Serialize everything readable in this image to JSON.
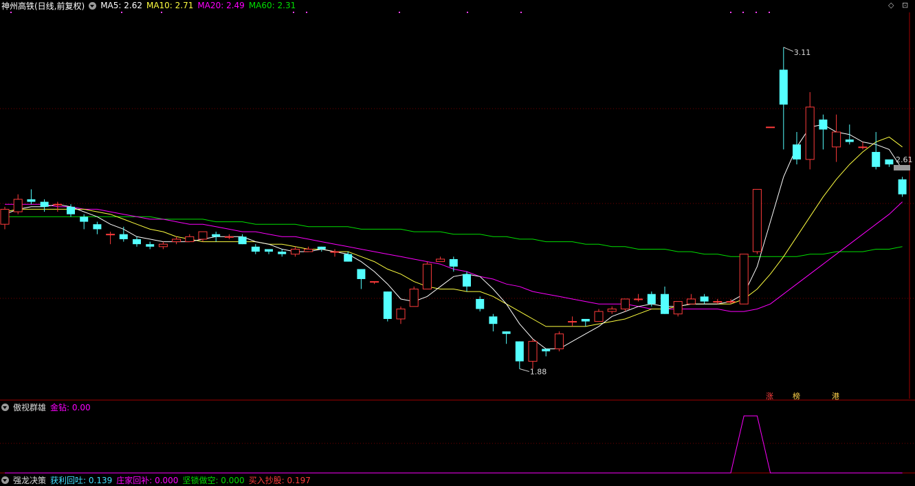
{
  "header": {
    "title": "神州高铁(日线,前复权)",
    "ma5": "MA5: 2.62",
    "ma10": "MA10: 2.71",
    "ma20": "MA20: 2.49",
    "ma60": "MA60: 2.31"
  },
  "sub_panel": {
    "name": "傲视群雄",
    "value": "金钻: 0.00"
  },
  "bottom_panel": {
    "name": "强龙决策",
    "items": [
      "获利回吐: 0.139",
      "庄家回补: 0.000",
      "坚锁做空: 0.000",
      "买入抄股: 0.197"
    ]
  },
  "colors": {
    "up": "#ff3b3b",
    "down": "#54ffff",
    "ma5": "#ffffff",
    "ma10": "#ffff40",
    "ma20": "#ff00ff",
    "ma60": "#00e000",
    "grid": "#7a0000"
  },
  "chart_data": {
    "type": "candlestick",
    "ylim": [
      1.7,
      3.25
    ],
    "candles": [
      [
        2.4,
        2.46,
        2.38,
        2.47
      ],
      [
        2.45,
        2.5,
        2.44,
        2.52
      ],
      [
        2.5,
        2.49,
        2.48,
        2.54
      ],
      [
        2.49,
        2.47,
        2.45,
        2.5
      ],
      [
        2.48,
        2.48,
        2.45,
        2.49
      ],
      [
        2.47,
        2.44,
        2.43,
        2.48
      ],
      [
        2.43,
        2.41,
        2.38,
        2.44
      ],
      [
        2.4,
        2.38,
        2.36,
        2.41
      ],
      [
        2.36,
        2.36,
        2.32,
        2.37
      ],
      [
        2.36,
        2.34,
        2.33,
        2.39
      ],
      [
        2.34,
        2.32,
        2.31,
        2.35
      ],
      [
        2.32,
        2.31,
        2.3,
        2.33
      ],
      [
        2.31,
        2.32,
        2.3,
        2.33
      ],
      [
        2.33,
        2.34,
        2.32,
        2.35
      ],
      [
        2.33,
        2.35,
        2.33,
        2.36
      ],
      [
        2.34,
        2.37,
        2.33,
        2.37
      ],
      [
        2.36,
        2.35,
        2.33,
        2.37
      ],
      [
        2.35,
        2.35,
        2.34,
        2.36
      ],
      [
        2.35,
        2.32,
        2.32,
        2.36
      ],
      [
        2.31,
        2.29,
        2.28,
        2.32
      ],
      [
        2.3,
        2.29,
        2.28,
        2.3
      ],
      [
        2.29,
        2.28,
        2.27,
        2.3
      ],
      [
        2.28,
        2.3,
        2.27,
        2.31
      ],
      [
        2.29,
        2.3,
        2.29,
        2.31
      ],
      [
        2.31,
        2.3,
        2.29,
        2.31
      ],
      [
        2.29,
        2.29,
        2.27,
        2.3
      ],
      [
        2.28,
        2.25,
        2.25,
        2.29
      ],
      [
        2.22,
        2.18,
        2.14,
        2.22
      ],
      [
        2.17,
        2.17,
        2.16,
        2.17
      ],
      [
        2.13,
        2.02,
        2.01,
        2.13
      ],
      [
        2.02,
        2.06,
        2.0,
        2.07
      ],
      [
        2.07,
        2.14,
        2.07,
        2.15
      ],
      [
        2.14,
        2.24,
        2.14,
        2.25
      ],
      [
        2.25,
        2.26,
        2.25,
        2.27
      ],
      [
        2.26,
        2.23,
        2.21,
        2.27
      ],
      [
        2.2,
        2.15,
        2.13,
        2.21
      ],
      [
        2.1,
        2.06,
        2.05,
        2.11
      ],
      [
        2.03,
        2.0,
        1.97,
        2.04
      ],
      [
        1.97,
        1.96,
        1.92,
        1.97
      ],
      [
        1.93,
        1.85,
        1.82,
        1.93
      ],
      [
        1.85,
        1.93,
        1.82,
        1.94
      ],
      [
        1.9,
        1.89,
        1.87,
        1.9
      ],
      [
        1.9,
        1.96,
        1.89,
        1.97
      ],
      [
        2.01,
        2.01,
        1.99,
        2.03
      ],
      [
        2.02,
        2.01,
        1.99,
        2.02
      ],
      [
        2.01,
        2.05,
        2.01,
        2.06
      ],
      [
        2.05,
        2.06,
        2.04,
        2.07
      ],
      [
        2.06,
        2.1,
        2.05,
        2.1
      ],
      [
        2.1,
        2.1,
        2.09,
        2.12
      ],
      [
        2.12,
        2.08,
        2.07,
        2.13
      ],
      [
        2.12,
        2.04,
        2.04,
        2.15
      ],
      [
        2.04,
        2.09,
        2.03,
        2.09
      ],
      [
        2.08,
        2.1,
        2.08,
        2.12
      ],
      [
        2.11,
        2.09,
        2.08,
        2.12
      ],
      [
        2.09,
        2.09,
        2.08,
        2.1
      ],
      [
        2.09,
        2.09,
        2.08,
        2.1
      ],
      [
        2.08,
        2.28,
        2.08,
        2.28
      ],
      [
        2.29,
        2.54,
        2.28,
        2.54
      ],
      [
        2.79,
        2.79,
        2.79,
        2.79
      ],
      [
        3.02,
        2.88,
        2.7,
        3.11
      ],
      [
        2.72,
        2.66,
        2.64,
        2.77
      ],
      [
        2.66,
        2.87,
        2.62,
        2.93
      ],
      [
        2.82,
        2.78,
        2.7,
        2.84
      ],
      [
        2.71,
        2.77,
        2.65,
        2.84
      ],
      [
        2.74,
        2.73,
        2.72,
        2.8
      ],
      [
        2.71,
        2.71,
        2.7,
        2.73
      ],
      [
        2.69,
        2.63,
        2.62,
        2.77
      ],
      [
        2.66,
        2.64,
        2.63,
        2.65
      ],
      [
        2.58,
        2.52,
        2.51,
        2.59
      ]
    ],
    "ma5": [
      2.44,
      2.46,
      2.47,
      2.47,
      2.48,
      2.47,
      2.45,
      2.43,
      2.4,
      2.38,
      2.35,
      2.34,
      2.33,
      2.33,
      2.33,
      2.34,
      2.35,
      2.35,
      2.35,
      2.33,
      2.32,
      2.3,
      2.29,
      2.29,
      2.3,
      2.29,
      2.28,
      2.25,
      2.21,
      2.16,
      2.1,
      2.09,
      2.11,
      2.15,
      2.19,
      2.2,
      2.19,
      2.14,
      2.08,
      2.0,
      1.94,
      1.9,
      1.9,
      1.93,
      1.96,
      1.99,
      2.03,
      2.05,
      2.07,
      2.08,
      2.07,
      2.07,
      2.08,
      2.08,
      2.08,
      2.09,
      2.12,
      2.23,
      2.41,
      2.59,
      2.71,
      2.79,
      2.8,
      2.77,
      2.76,
      2.73,
      2.72,
      2.7,
      2.62
    ],
    "ma10": [
      2.45,
      2.46,
      2.46,
      2.46,
      2.46,
      2.46,
      2.46,
      2.45,
      2.44,
      2.42,
      2.4,
      2.38,
      2.37,
      2.35,
      2.34,
      2.33,
      2.33,
      2.33,
      2.33,
      2.33,
      2.32,
      2.32,
      2.31,
      2.3,
      2.3,
      2.29,
      2.29,
      2.27,
      2.25,
      2.22,
      2.2,
      2.17,
      2.15,
      2.14,
      2.14,
      2.13,
      2.13,
      2.11,
      2.08,
      2.05,
      2.02,
      1.99,
      1.99,
      1.99,
      1.99,
      2.0,
      2.01,
      2.02,
      2.04,
      2.06,
      2.06,
      2.07,
      2.08,
      2.08,
      2.08,
      2.08,
      2.1,
      2.14,
      2.2,
      2.27,
      2.35,
      2.43,
      2.51,
      2.58,
      2.64,
      2.69,
      2.73,
      2.75,
      2.71
    ],
    "ma20": [
      2.48,
      2.48,
      2.48,
      2.48,
      2.47,
      2.47,
      2.46,
      2.46,
      2.45,
      2.44,
      2.43,
      2.42,
      2.42,
      2.41,
      2.4,
      2.4,
      2.39,
      2.38,
      2.37,
      2.37,
      2.36,
      2.35,
      2.35,
      2.34,
      2.33,
      2.32,
      2.31,
      2.3,
      2.29,
      2.28,
      2.27,
      2.26,
      2.25,
      2.24,
      2.22,
      2.21,
      2.19,
      2.18,
      2.16,
      2.15,
      2.13,
      2.12,
      2.11,
      2.1,
      2.09,
      2.08,
      2.08,
      2.08,
      2.07,
      2.06,
      2.06,
      2.06,
      2.06,
      2.06,
      2.06,
      2.05,
      2.05,
      2.06,
      2.08,
      2.12,
      2.16,
      2.2,
      2.24,
      2.28,
      2.32,
      2.36,
      2.4,
      2.44,
      2.49
    ],
    "ma60": [
      2.43,
      2.43,
      2.43,
      2.43,
      2.43,
      2.43,
      2.43,
      2.43,
      2.43,
      2.43,
      2.43,
      2.43,
      2.42,
      2.42,
      2.42,
      2.42,
      2.41,
      2.41,
      2.41,
      2.4,
      2.4,
      2.4,
      2.4,
      2.39,
      2.39,
      2.39,
      2.39,
      2.38,
      2.38,
      2.38,
      2.38,
      2.37,
      2.37,
      2.37,
      2.36,
      2.36,
      2.36,
      2.35,
      2.35,
      2.34,
      2.34,
      2.33,
      2.33,
      2.33,
      2.32,
      2.32,
      2.31,
      2.31,
      2.3,
      2.3,
      2.3,
      2.29,
      2.29,
      2.28,
      2.28,
      2.27,
      2.27,
      2.27,
      2.27,
      2.27,
      2.27,
      2.28,
      2.28,
      2.29,
      2.29,
      2.29,
      2.3,
      2.3,
      2.31
    ],
    "annotations": {
      "high_label": "3.11",
      "low_label": "1.88",
      "last_label": "2.61"
    },
    "markers": [
      "涨",
      "榜",
      "港"
    ],
    "indicator": [
      0,
      0,
      0,
      0,
      0,
      0,
      0,
      0,
      0,
      0,
      0,
      0,
      0,
      0,
      0,
      0,
      0,
      0,
      0,
      0,
      0,
      0,
      0,
      0,
      0,
      0,
      0,
      0,
      0,
      0,
      0,
      0,
      0,
      0,
      0,
      0,
      0,
      0,
      0,
      0,
      0,
      0,
      0,
      0,
      0,
      0,
      0,
      0,
      0,
      0,
      0,
      0,
      0,
      0,
      0,
      0,
      1,
      1,
      0,
      0,
      0,
      0,
      0,
      0,
      0,
      0,
      0,
      0,
      0
    ]
  }
}
